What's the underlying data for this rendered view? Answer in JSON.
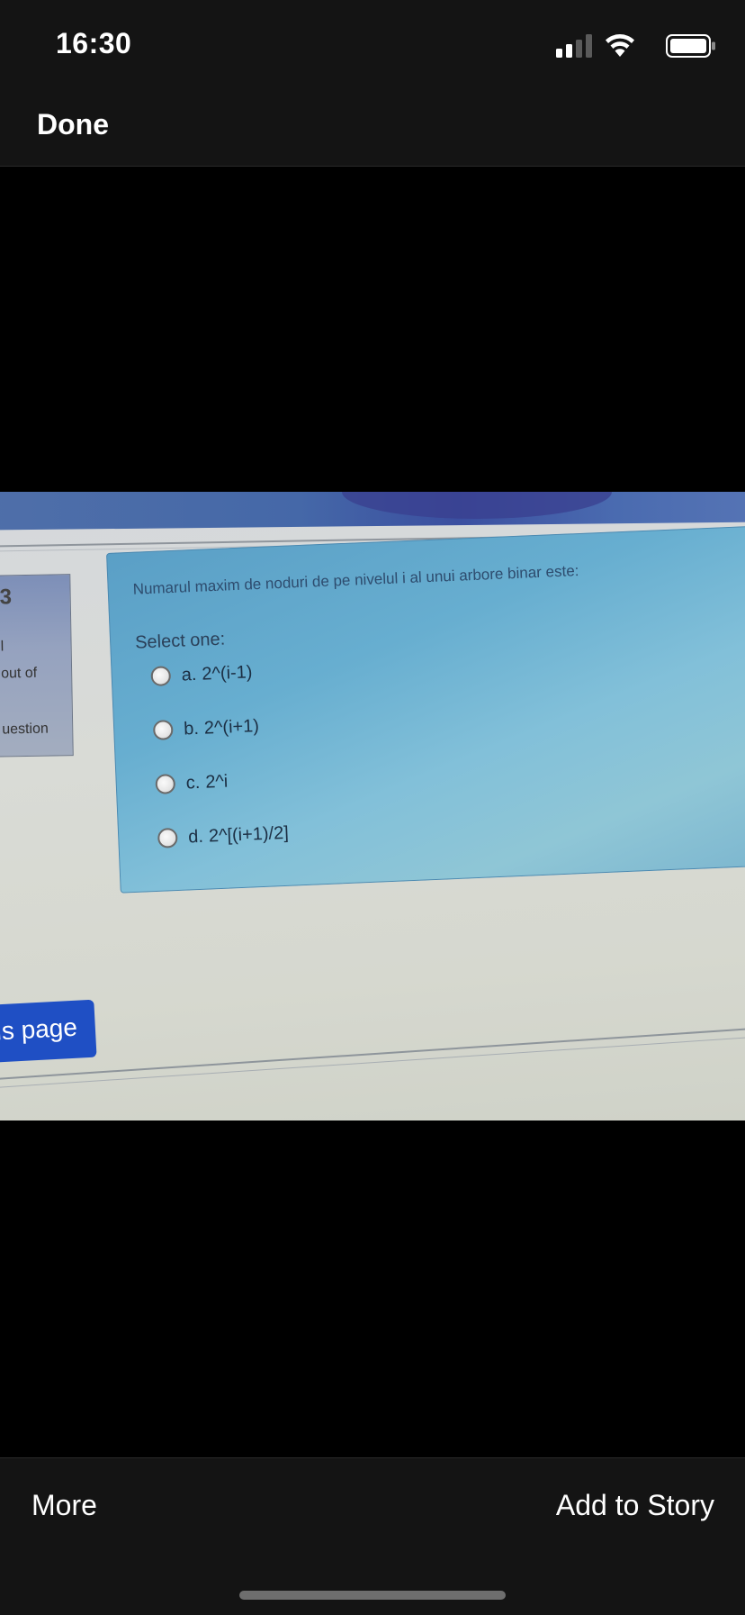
{
  "status_bar": {
    "time": "16:30",
    "icons": [
      "signal-icon",
      "wifi-icon",
      "battery-icon"
    ]
  },
  "nav": {
    "done_label": "Done"
  },
  "photo": {
    "question_nav": {
      "number": "3",
      "status": "l",
      "marks": "out of",
      "flag": "uestion"
    },
    "question_text": "Numarul maxim de noduri de pe nivelul i al unui arbore binar este:",
    "prompt": "Select one:",
    "options": [
      {
        "letter": "a.",
        "text": "2^(i-1)"
      },
      {
        "letter": "b.",
        "text": "2^(i+1)"
      },
      {
        "letter": "c.",
        "text": "2^i"
      },
      {
        "letter": "d.",
        "text": "2^[(i+1)/2]"
      }
    ],
    "prev_page_label": "us page"
  },
  "bottom_bar": {
    "more_label": "More",
    "story_label": "Add to Story"
  },
  "colors": {
    "bar_bg": "#141414",
    "question_box": "#67aed0",
    "prev_button": "#1f4fc4"
  }
}
